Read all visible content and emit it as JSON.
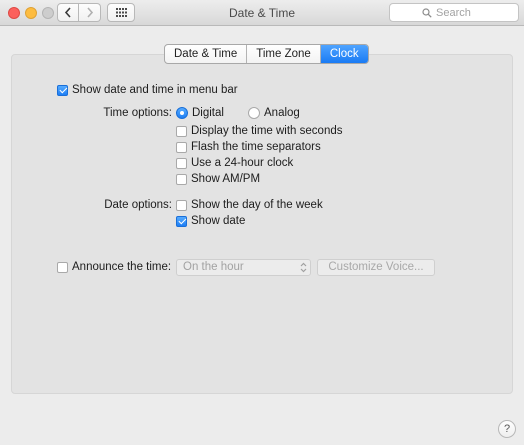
{
  "window": {
    "title": "Date & Time"
  },
  "search": {
    "placeholder": "Search"
  },
  "tabs": [
    {
      "label": "Date & Time",
      "active": false
    },
    {
      "label": "Time Zone",
      "active": false
    },
    {
      "label": "Clock",
      "active": true
    }
  ],
  "clock": {
    "show_in_menu_bar": {
      "label": "Show date and time in menu bar",
      "checked": true
    },
    "time_options_label": "Time options:",
    "time_style": [
      {
        "label": "Digital",
        "selected": true
      },
      {
        "label": "Analog",
        "selected": false
      }
    ],
    "time_checks": [
      {
        "label": "Display the time with seconds",
        "checked": false
      },
      {
        "label": "Flash the time separators",
        "checked": false
      },
      {
        "label": "Use a 24-hour clock",
        "checked": false
      },
      {
        "label": "Show AM/PM",
        "checked": false
      }
    ],
    "date_options_label": "Date options:",
    "date_checks": [
      {
        "label": "Show the day of the week",
        "checked": false
      },
      {
        "label": "Show date",
        "checked": true
      }
    ],
    "announce": {
      "label": "Announce the time:",
      "checked": false
    },
    "announce_interval": "On the hour",
    "customize_voice": "Customize Voice..."
  },
  "help_label": "?",
  "colors": {
    "accent": "#1a7bf4",
    "close": "#fc605c",
    "minimize": "#fdbc40",
    "zoom": "#cdcdcd"
  }
}
